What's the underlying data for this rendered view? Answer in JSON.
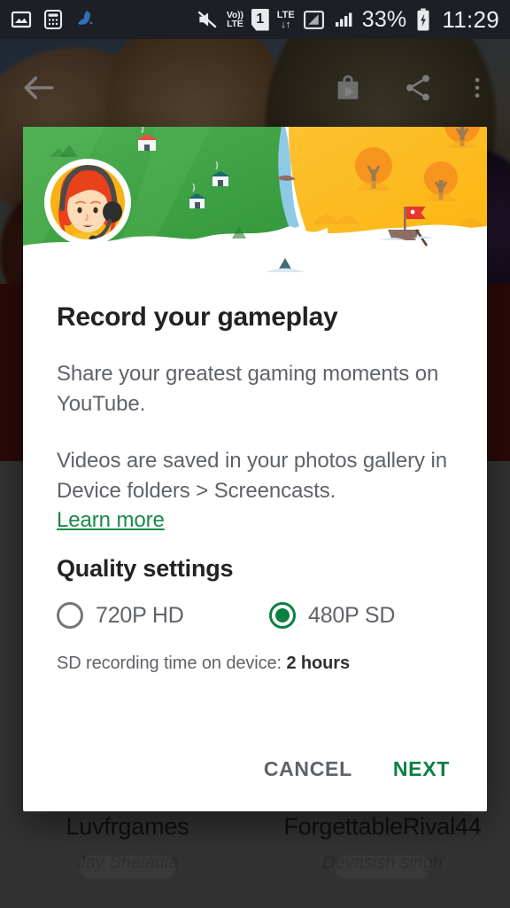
{
  "status_bar": {
    "time": "11:29",
    "battery_percent": "33%",
    "volte_line1": "Vo))",
    "volte_line2": "LTE",
    "sim_number": "1",
    "lte_line1": "LTE",
    "lte_line2": "↓↑",
    "icons": {
      "photo": "photo-icon",
      "calculator": "calculator-icon",
      "app": "app-icon",
      "mute": "volume-mute-icon",
      "volte": "volte-icon",
      "sim": "sim-card-icon",
      "lte_data": "lte-data-icon",
      "signal1": "signal-bars-icon",
      "signal2": "signal-bars-icon",
      "battery": "battery-charging-icon"
    }
  },
  "app_bar": {
    "back": "back-arrow-icon",
    "store": "play-store-icon",
    "share": "share-icon",
    "overflow": "more-vertical-icon"
  },
  "dialog": {
    "title": "Record your gameplay",
    "paragraph_1": "Share your greatest gaming moments on YouTube.",
    "paragraph_2": "Videos are saved in your photos gallery in Device folders > Screencasts.",
    "learn_more": "Learn more",
    "quality_heading": "Quality settings",
    "options": [
      {
        "label": "720P HD",
        "selected": false
      },
      {
        "label": "480P SD",
        "selected": true
      }
    ],
    "note_prefix": "SD recording time on device: ",
    "note_value": "2 hours",
    "cancel_label": "CANCEL",
    "next_label": "NEXT",
    "illustration_name": "gamer-avatar-landscape-illustration"
  },
  "background_cards": [
    {
      "title": "Luvfrgames",
      "subtitle": "Jay Sheladia"
    },
    {
      "title": "ForgettableRival44",
      "subtitle": "Devasish singh"
    }
  ],
  "colors": {
    "accent_green": "#0b8043",
    "link_green": "#1a8a4b",
    "status_bar_bg": "#1c1f25",
    "dialog_bg": "#ffffff",
    "scrim": "rgba(0,0,0,0.46)",
    "land_green": "#43a047",
    "land_yellow": "#fbbc15",
    "avatar_ring": "#f9b215",
    "hair_orange": "#e8411c",
    "red_band": "#4d140f",
    "page_grey": "#5d5d5d"
  }
}
